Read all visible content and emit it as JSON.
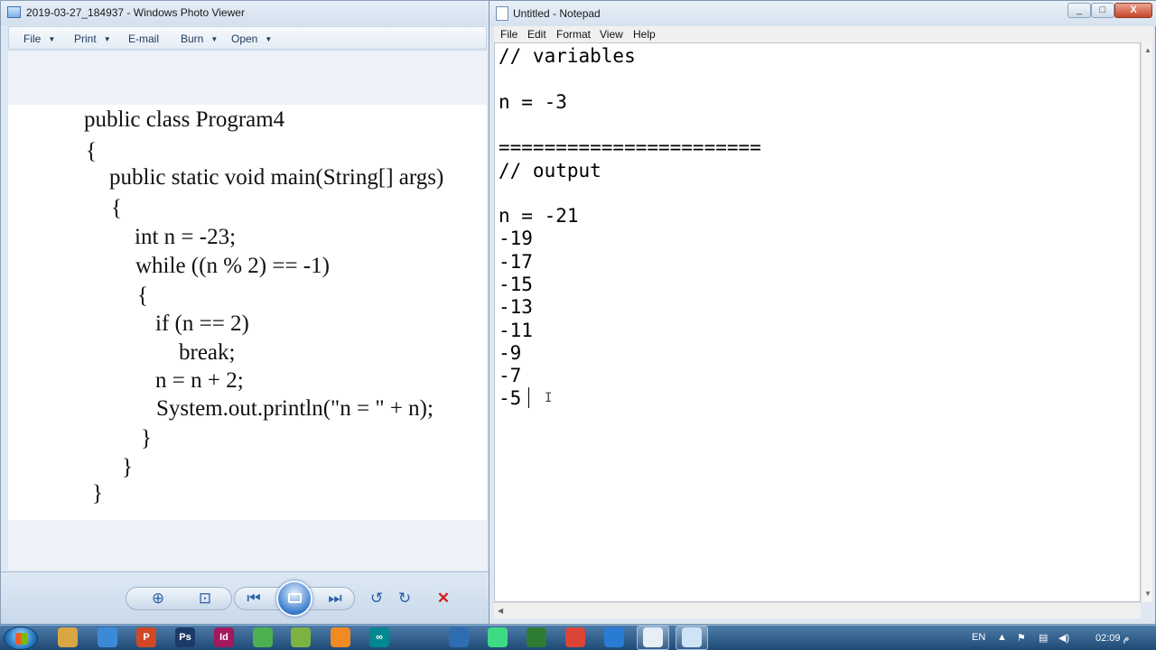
{
  "photo_viewer": {
    "title": "2019-03-27_184937 - Windows Photo Viewer",
    "menu": [
      "File",
      "Print",
      "E-mail",
      "Burn",
      "Open"
    ],
    "code_lines": [
      "public class Program4",
      "{",
      "public static void main(String[] args)",
      "{",
      "int n = -23;",
      "while ((n % 2) == -1)",
      "{",
      "if (n == 2)",
      "break;",
      "n = n + 2;",
      "System.out.println(\"n = \" + n);",
      "}",
      "}",
      "}"
    ]
  },
  "notepad": {
    "title": "Untitled - Notepad",
    "window_buttons": [
      "_",
      "□",
      "X"
    ],
    "menu": [
      "File",
      "Edit",
      "Format",
      "View",
      "Help"
    ],
    "lines": [
      "// variables",
      "",
      "n = -3",
      "",
      "=======================",
      "// output",
      "",
      "n = -21",
      "-19",
      "-17",
      "-15",
      "-13",
      "-11",
      "-9",
      "-7",
      "-5"
    ]
  },
  "taskbar": {
    "apps": [
      {
        "icon": "folder-icon",
        "color": "#d8a642"
      },
      {
        "icon": "browser-icon",
        "color": "#3b8ad8"
      },
      {
        "icon": "powerpoint-icon",
        "label": "P",
        "color": "#d24726"
      },
      {
        "icon": "photoshop-icon",
        "label": "Ps",
        "color": "#1c3a66"
      },
      {
        "icon": "indesign-icon",
        "label": "Id",
        "color": "#a3195b"
      },
      {
        "icon": "network-icon",
        "color": "#4caf50"
      },
      {
        "icon": "android-icon",
        "color": "#7cb342"
      },
      {
        "icon": "vlc-icon",
        "color": "#f08a24"
      },
      {
        "icon": "arduino-icon",
        "label": "∞",
        "color": "#00878f"
      },
      {
        "icon": "virtualbox-icon",
        "color": "#2f6db3"
      },
      {
        "icon": "android-studio-icon",
        "color": "#3ddc84"
      },
      {
        "icon": "globe-icon",
        "color": "#2e7d32"
      },
      {
        "icon": "chrome-icon",
        "color": "#db4437"
      },
      {
        "icon": "vscode-icon",
        "color": "#2a7bd4"
      },
      {
        "icon": "notepad-icon",
        "color": "#e8eef5"
      },
      {
        "icon": "photo-viewer-icon",
        "color": "#cfe3f7"
      }
    ],
    "language": "EN",
    "clock": "02:09 م"
  }
}
